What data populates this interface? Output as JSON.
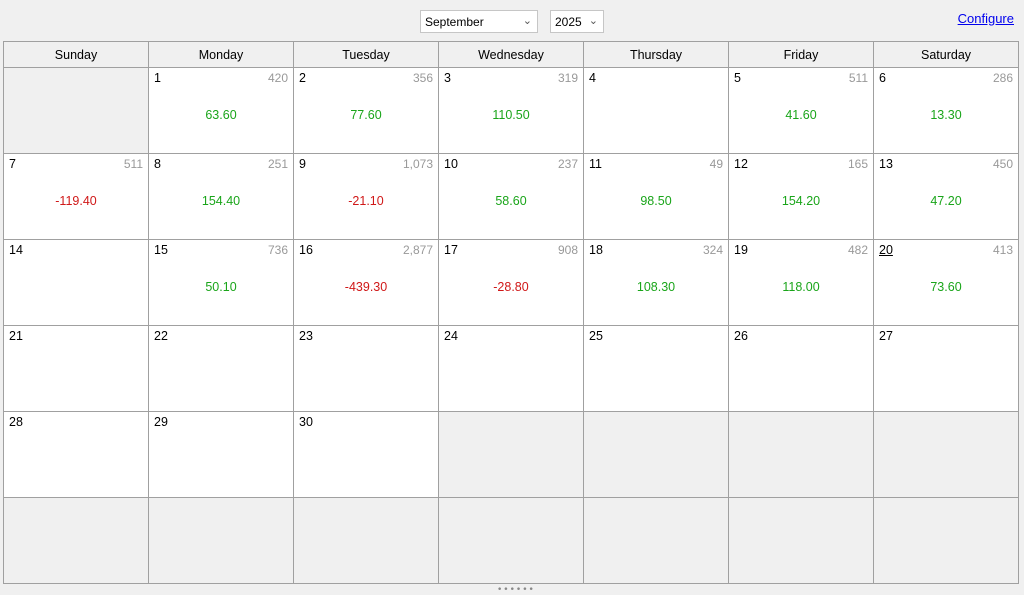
{
  "toolbar": {
    "month": "September",
    "year": "2025",
    "configure": "Configure",
    "chevron_icon": "chevron-down-icon"
  },
  "weekdays": [
    "Sunday",
    "Monday",
    "Tuesday",
    "Wednesday",
    "Thursday",
    "Friday",
    "Saturday"
  ],
  "today": "20",
  "days": [
    {
      "day": "1",
      "count": "420",
      "pnl": "63.60"
    },
    {
      "day": "2",
      "count": "356",
      "pnl": "77.60"
    },
    {
      "day": "3",
      "count": "319",
      "pnl": "110.50"
    },
    {
      "day": "4",
      "count": "",
      "pnl": ""
    },
    {
      "day": "5",
      "count": "511",
      "pnl": "41.60"
    },
    {
      "day": "6",
      "count": "286",
      "pnl": "13.30"
    },
    {
      "day": "7",
      "count": "511",
      "pnl": "-119.40"
    },
    {
      "day": "8",
      "count": "251",
      "pnl": "154.40"
    },
    {
      "day": "9",
      "count": "1,073",
      "pnl": "-21.10"
    },
    {
      "day": "10",
      "count": "237",
      "pnl": "58.60"
    },
    {
      "day": "11",
      "count": "49",
      "pnl": "98.50"
    },
    {
      "day": "12",
      "count": "165",
      "pnl": "154.20"
    },
    {
      "day": "13",
      "count": "450",
      "pnl": "47.20"
    },
    {
      "day": "14",
      "count": "",
      "pnl": ""
    },
    {
      "day": "15",
      "count": "736",
      "pnl": "50.10"
    },
    {
      "day": "16",
      "count": "2,877",
      "pnl": "-439.30"
    },
    {
      "day": "17",
      "count": "908",
      "pnl": "-28.80"
    },
    {
      "day": "18",
      "count": "324",
      "pnl": "108.30"
    },
    {
      "day": "19",
      "count": "482",
      "pnl": "118.00"
    },
    {
      "day": "20",
      "count": "413",
      "pnl": "73.60"
    },
    {
      "day": "21",
      "count": "",
      "pnl": ""
    },
    {
      "day": "22",
      "count": "",
      "pnl": ""
    },
    {
      "day": "23",
      "count": "",
      "pnl": ""
    },
    {
      "day": "24",
      "count": "",
      "pnl": ""
    },
    {
      "day": "25",
      "count": "",
      "pnl": ""
    },
    {
      "day": "26",
      "count": "",
      "pnl": ""
    },
    {
      "day": "27",
      "count": "",
      "pnl": ""
    },
    {
      "day": "28",
      "count": "",
      "pnl": ""
    },
    {
      "day": "29",
      "count": "",
      "pnl": ""
    },
    {
      "day": "30",
      "count": "",
      "pnl": ""
    }
  ],
  "colors": {
    "positive": "#1aa51a",
    "negative": "#d01818",
    "muted": "#999999"
  }
}
